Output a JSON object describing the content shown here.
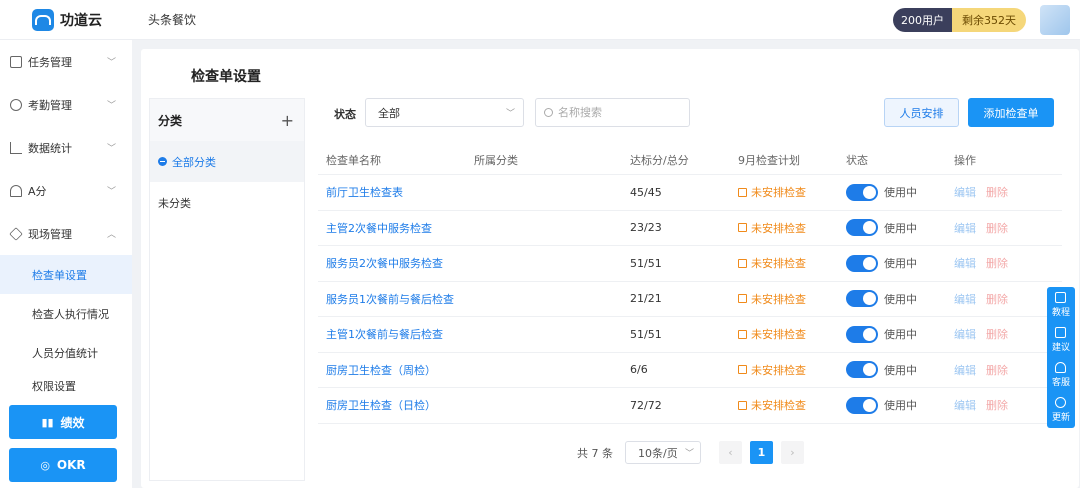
{
  "brand": {
    "name": "功道云"
  },
  "org": "头条餐饮",
  "plan": {
    "users": "200用户",
    "days": "剩余352天"
  },
  "sidebar": {
    "items": [
      {
        "label": "任务管理",
        "icon": "task-icon"
      },
      {
        "label": "考勤管理",
        "icon": "attendance-icon"
      },
      {
        "label": "数据统计",
        "icon": "chart-icon"
      },
      {
        "label": "A分",
        "icon": "score-icon"
      },
      {
        "label": "现场管理",
        "icon": "layers-icon"
      }
    ],
    "sub_items": [
      "检查单设置",
      "检查人执行情况",
      "人员分值统计",
      "权限设置"
    ],
    "btn_perf": "绩效",
    "btn_okr": "OKR"
  },
  "page": {
    "title": "检查单设置"
  },
  "categories": {
    "header": "分类",
    "items": [
      "全部分类",
      "未分类"
    ]
  },
  "filters": {
    "status_label": "状态",
    "status_value": "全部",
    "search_placeholder": "名称搜索"
  },
  "buttons": {
    "staff": "人员安排",
    "add": "添加检查单"
  },
  "table": {
    "headers": [
      "检查单名称",
      "所属分类",
      "达标分/总分",
      "9月检查计划",
      "状态",
      "操作"
    ],
    "rows": [
      {
        "name": "前厅卫生检查表",
        "category": "",
        "score": "45/45",
        "plan": "未安排检查",
        "status": "使用中"
      },
      {
        "name": "主管2次餐中服务检查",
        "category": "",
        "score": "23/23",
        "plan": "未安排检查",
        "status": "使用中"
      },
      {
        "name": "服务员2次餐中服务检查",
        "category": "",
        "score": "51/51",
        "plan": "未安排检查",
        "status": "使用中"
      },
      {
        "name": "服务员1次餐前与餐后检查",
        "category": "",
        "score": "21/21",
        "plan": "未安排检查",
        "status": "使用中"
      },
      {
        "name": "主管1次餐前与餐后检查",
        "category": "",
        "score": "51/51",
        "plan": "未安排检查",
        "status": "使用中"
      },
      {
        "name": "厨房卫生检查（周检）",
        "category": "",
        "score": "6/6",
        "plan": "未安排检查",
        "status": "使用中"
      },
      {
        "name": "厨房卫生检查（日检）",
        "category": "",
        "score": "72/72",
        "plan": "未安排检查",
        "status": "使用中"
      }
    ],
    "op_edit": "编辑",
    "op_delete": "删除"
  },
  "pagination": {
    "total": "共 7 条",
    "page_size": "10条/页",
    "current": "1"
  },
  "tools": [
    "教程",
    "建议",
    "客服",
    "更新"
  ],
  "colors": {
    "primary": "#1a94f5",
    "warning": "#f08a1a"
  }
}
